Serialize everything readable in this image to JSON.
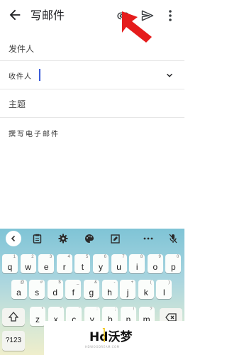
{
  "appbar": {
    "title": "写邮件",
    "icons": [
      "back-arrow-icon",
      "attachment-icon",
      "send-icon",
      "more-vertical-icon"
    ]
  },
  "annotation": {
    "color": "#e51c1c"
  },
  "form": {
    "from_label": "发件人",
    "to_label": "收件人",
    "subject_label": "主题",
    "compose_label": "撰写电子邮件",
    "caret_color": "#3a5bd9"
  },
  "keyboard": {
    "toolbar_icons": [
      "collapse-icon",
      "clipboard-icon",
      "settings-icon",
      "palette-icon",
      "edit-icon",
      "more-horizontal-icon",
      "mic-off-icon"
    ],
    "row1": [
      {
        "k": "q",
        "s": "1"
      },
      {
        "k": "w",
        "s": "2"
      },
      {
        "k": "e",
        "s": "3"
      },
      {
        "k": "r",
        "s": "4"
      },
      {
        "k": "t",
        "s": "5"
      },
      {
        "k": "y",
        "s": "6"
      },
      {
        "k": "u",
        "s": "7"
      },
      {
        "k": "i",
        "s": "8"
      },
      {
        "k": "o",
        "s": "9"
      },
      {
        "k": "p",
        "s": "0"
      }
    ],
    "row2": [
      {
        "k": "a",
        "s": "@"
      },
      {
        "k": "s",
        "s": "#"
      },
      {
        "k": "d",
        "s": "$"
      },
      {
        "k": "f",
        "s": "_"
      },
      {
        "k": "g",
        "s": "&"
      },
      {
        "k": "h",
        "s": "-"
      },
      {
        "k": "j",
        "s": "+"
      },
      {
        "k": "k",
        "s": "("
      },
      {
        "k": "l",
        "s": ")"
      }
    ],
    "row3": [
      {
        "k": "z",
        "s": "*"
      },
      {
        "k": "x",
        "s": "\""
      },
      {
        "k": "c",
        "s": "'"
      },
      {
        "k": "v",
        "s": ":"
      },
      {
        "k": "b",
        "s": ";"
      },
      {
        "k": "n",
        "s": "!"
      },
      {
        "k": "m",
        "s": "?"
      }
    ],
    "symbols_label": "?123",
    "shift_icon": "shift-icon",
    "backspace_icon": "backspace-icon"
  },
  "watermark": {
    "logo": "Hd沃梦",
    "sub": "HDWOODREAM.COM"
  }
}
